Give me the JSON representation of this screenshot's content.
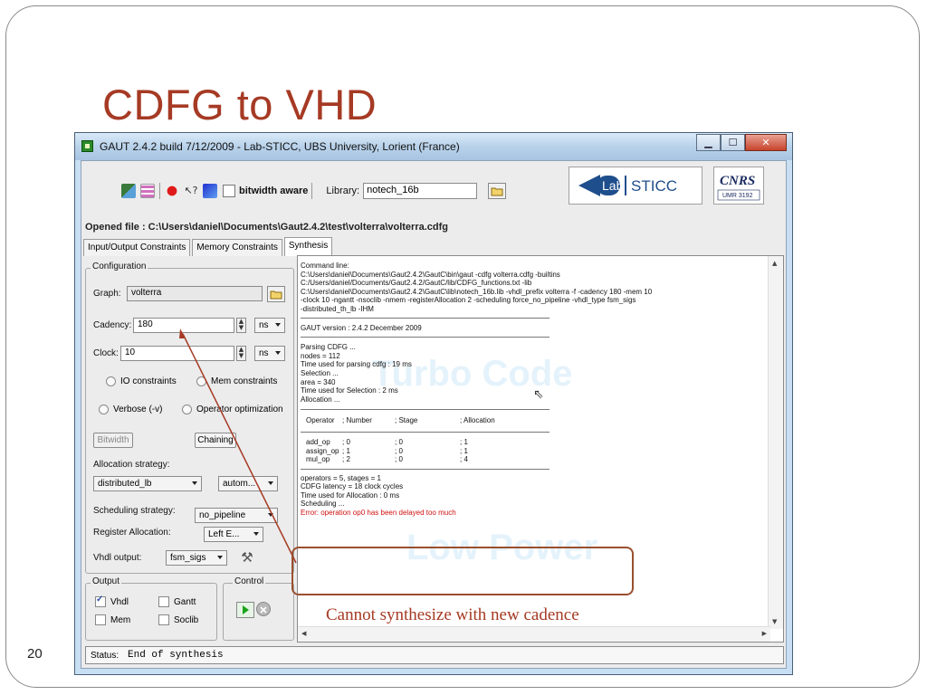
{
  "slide": {
    "title": "CDFG to VHD",
    "number": "20",
    "annotation": "Cannot synthesize with new cadence",
    "accent_color": "#a63a24"
  },
  "window": {
    "title": "GAUT 2.4.2 build 7/12/2009 - Lab-STICC, UBS University, Lorient (France)",
    "controls": [
      "minimize-icon",
      "maximize-icon",
      "close-icon"
    ],
    "toolbar": {
      "icons": [
        "graph-tool-icon",
        "timeline-icon",
        "bug-icon",
        "help-cursor-icon",
        "module-icon"
      ],
      "bitwidth_label": "bitwidth aware",
      "library_label": "Library:",
      "library_value": "notech_16b"
    },
    "logos": {
      "lab": "Lab-STICC",
      "lab_lab": "Lab",
      "lab_sticc": "STICC",
      "cnrs": "CNRS",
      "cnrs_unit": "UMR 3192"
    },
    "opened_file": "Opened file : C:\\Users\\daniel\\Documents\\Gaut2.4.2\\test\\volterra\\volterra.cdfg",
    "tabs": [
      {
        "label": "Input/Output Constraints",
        "active": false
      },
      {
        "label": "Memory Constraints",
        "active": false
      },
      {
        "label": "Synthesis",
        "active": true
      }
    ]
  },
  "configuration": {
    "legend": "Configuration",
    "graph_label": "Graph:",
    "graph_value": "volterra",
    "cadency_label": "Cadency:",
    "cadency_value": "180",
    "cadency_unit": "ns",
    "clock_label": "Clock:",
    "clock_value": "10",
    "clock_unit": "ns",
    "io_constraints": "IO constraints",
    "mem_constraints": "Mem constraints",
    "verbose": "Verbose (-v)",
    "operator_optimization": "Operator optimization",
    "bitwidth_button": "Bitwidth",
    "chaining_button": "Chaining",
    "allocation_label": "Allocation strategy:",
    "allocation_value": "distributed_lb",
    "allocation_mode": "autom...",
    "scheduling_label": "Scheduling strategy:",
    "scheduling_value": "no_pipeline",
    "register_label": "Register Allocation:",
    "register_value": "Left E...",
    "vhdl_label": "Vhdl output:",
    "vhdl_value": "fsm_sigs"
  },
  "output": {
    "legend": "Output",
    "vhdl": {
      "label": "Vhdl",
      "checked": true
    },
    "gantt": {
      "label": "Gantt",
      "checked": false
    },
    "mem": {
      "label": "Mem",
      "checked": false
    },
    "soclib": {
      "label": "Soclib",
      "checked": false
    }
  },
  "control": {
    "legend": "Control"
  },
  "console": {
    "header_lines": [
      "Command line:",
      "C:\\Users\\daniel\\Documents\\Gaut2.4.2\\GautC\\bin\\gaut -cdfg volterra.cdfg -builtins",
      "C:/Users/daniel/Documents/Gaut2.4.2/GautC/lib/CDFG_functions.txt -lib",
      "C:\\Users\\daniel\\Documents\\Gaut2.4.2\\GautC\\lib\\notech_16b.lib -vhdl_prefix volterra -f -cadency 180 -mem 10",
      "-clock 10 -ngantt -nsoclib -nmem -registerAllocation 2 -scheduling force_no_pipeline -vhdl_type fsm_sigs",
      "-distributed_th_lb -IHM"
    ],
    "version_line": "GAUT  version : 2.4.2 December 2009",
    "progress_lines": [
      "Parsing CDFG ...",
      "nodes = 112",
      "Time used for parsing cdfg : 19 ms",
      "Selection ...",
      "area = 340",
      "Time used for Selection : 2 ms",
      "Allocation ..."
    ],
    "op_table": {
      "headers": [
        "Operator",
        "; Number",
        "; Stage",
        "; Allocation"
      ],
      "rows": [
        [
          "add_op",
          "; 0",
          "; 0",
          "; 1"
        ],
        [
          "assign_op",
          "; 1",
          "; 0",
          "; 1"
        ],
        [
          "mul_op",
          "; 2",
          "; 0",
          "; 4"
        ]
      ]
    },
    "summary_lines": [
      "operators = 5, stages = 1",
      "CDFG latency = 18 clock cycles",
      "Time used for Allocation : 0 ms",
      "Scheduling ..."
    ],
    "error_line": "Error: operation op0 has been delayed too much",
    "watermarks": [
      "Turbo Code",
      "Low Power"
    ]
  },
  "status": {
    "label": "Status:",
    "value": "End of synthesis"
  }
}
